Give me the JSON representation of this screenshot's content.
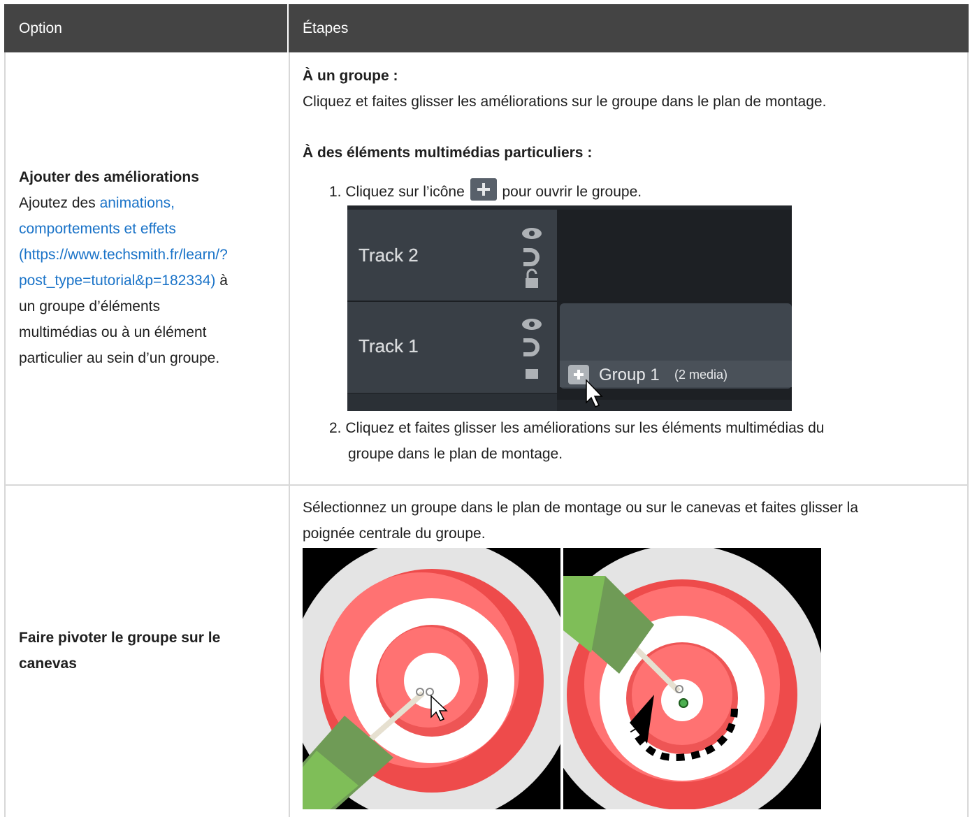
{
  "table": {
    "header": {
      "option": "Option",
      "steps": "Étapes"
    },
    "rows": [
      {
        "option_title": "Ajouter des améliorations",
        "option_text_before": "Ajoutez des ",
        "option_link_line1": "animations,",
        "option_link_line2": "comportements et effets",
        "option_link_line3": "(https://www.techsmith.fr/learn/?",
        "option_link_line4": "post_type=tutorial&p=182334)",
        "option_text_after_link": " à",
        "option_text_line5": "un groupe d’éléments",
        "option_text_line6": "multimédias ou à un élément",
        "option_text_line7": "particulier au sein d’un groupe.",
        "steps_heading1": "À un groupe :",
        "steps_para1": "Cliquez et faites glisser les améliorations sur le groupe dans le plan de montage.",
        "steps_heading2": "À des éléments multimédias particuliers :",
        "step1_num": "1.",
        "step1_before_icon": "Cliquez sur l’icône",
        "step1_after_icon": "pour ouvrir le groupe.",
        "step2_num": "2.",
        "step2_line1": "Cliquez et faites glisser les améliorations sur les éléments multimédias du",
        "step2_line2": "groupe dans le plan de montage.",
        "timeline": {
          "track2": "Track 2",
          "track1": "Track 1",
          "group_label": "Group 1",
          "group_count": "(2 media)"
        }
      },
      {
        "option_title_line1": "Faire pivoter le groupe sur le",
        "option_title_line2": "canevas",
        "steps_line1": "Sélectionnez un groupe dans le plan de montage ou sur le canevas et faites glisser la",
        "steps_line2": "poignée centrale du groupe."
      }
    ]
  },
  "colors": {
    "header_bg": "#444444",
    "link": "#1a73c8",
    "grid": "#d8d8d8",
    "timeline_bg": "#2b3036",
    "target_red": "#ee4b4b",
    "target_light_red": "#ff7070",
    "dart_green": "#7cbf57"
  },
  "icons": [
    "plus-icon",
    "eye-icon",
    "magnet-icon",
    "lock-icon",
    "cursor-icon",
    "rotate-arrow-icon"
  ]
}
